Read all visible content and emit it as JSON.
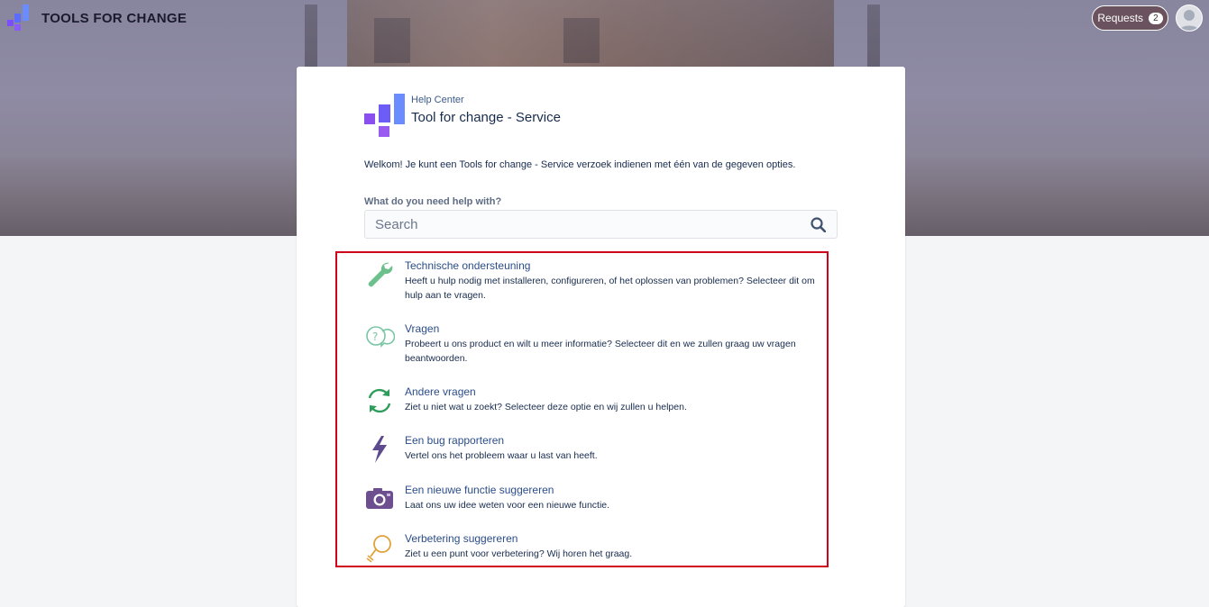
{
  "topbar": {
    "brand_name": "TOOLS FOR CHANGE",
    "requests_label": "Requests",
    "requests_count": "2"
  },
  "card": {
    "help_center_label": "Help Center",
    "title": "Tool for change - Service",
    "welcome": "Welkom! Je kunt een Tools for change - Service verzoek indienen met één van de gegeven opties.",
    "help_label": "What do you need help with?",
    "search_placeholder": "Search"
  },
  "options": [
    {
      "title": "Technische ondersteuning",
      "desc": "Heeft u hulp nodig met installeren, configureren, of het oplossen van problemen? Selecteer dit om hulp aan te vragen.",
      "icon": "wrench-icon"
    },
    {
      "title": "Vragen",
      "desc": "Probeert u ons product en wilt u meer informatie? Selecteer dit en we zullen graag uw vragen beantwoorden.",
      "icon": "question-bubbles-icon"
    },
    {
      "title": "Andere vragen",
      "desc": "Ziet u niet wat u zoekt? Selecteer deze optie en wij zullen u helpen.",
      "icon": "refresh-arrows-icon"
    },
    {
      "title": "Een bug rapporteren",
      "desc": "Vertel ons het probleem waar u last van heeft.",
      "icon": "lightning-icon"
    },
    {
      "title": "Een nieuwe functie suggereren",
      "desc": "Laat ons uw idee weten voor een nieuwe functie.",
      "icon": "camera-icon"
    },
    {
      "title": "Verbetering suggereren",
      "desc": "Ziet u een punt voor verbetering? Wij horen het graag.",
      "icon": "lightbulb-icon"
    }
  ],
  "colors": {
    "accent_link": "#2b4d8a",
    "highlight_border": "#d0021b",
    "logo_purple": "#8b5cf6",
    "logo_blue": "#6b8cff"
  }
}
